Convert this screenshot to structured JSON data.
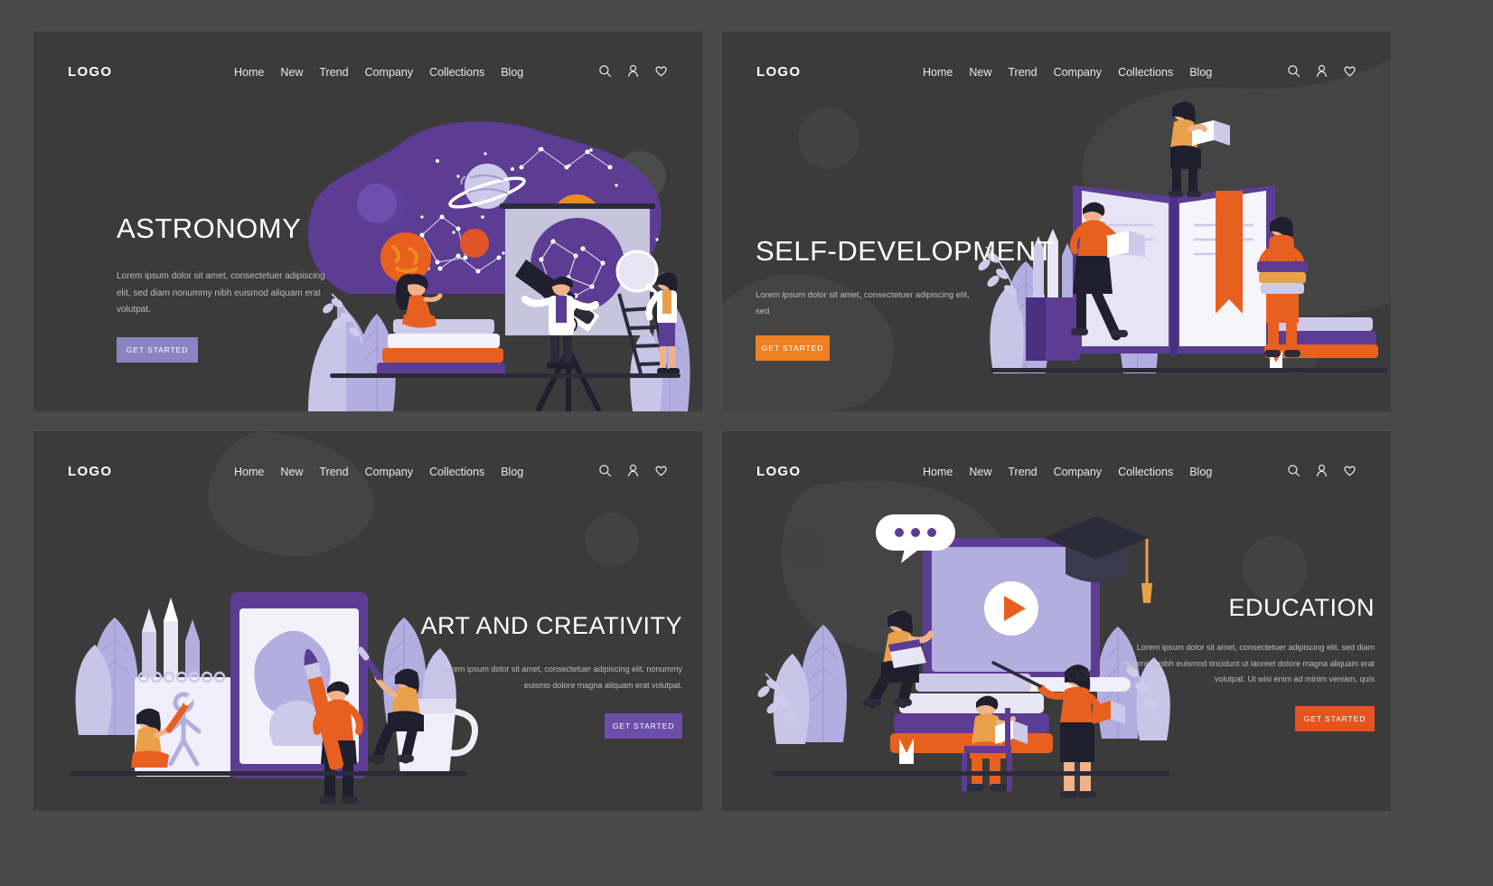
{
  "brand": {
    "logo": "LOGO"
  },
  "nav": {
    "items": [
      "Home",
      "New",
      "Trend",
      "Company",
      "Collections",
      "Blog"
    ],
    "icons": [
      "search-icon",
      "user-icon",
      "heart-icon"
    ]
  },
  "panels": [
    {
      "id": "astronomy",
      "title": "ASTRONOMY",
      "body": "Lorem ipsum dolor sit amet, consectetuer adipiscing elit, sed diam nonummy nibh euismod aliquam erat volutpat.",
      "cta": "GET STARTED",
      "cta_color": "#8b84c2",
      "align": "left",
      "illustration": "astronomy-scene"
    },
    {
      "id": "self-development",
      "title": "SELF-DEVELOPMENT",
      "body": "Lorem ipsum dolor sit amet, consectetuer adipiscing elit, sed",
      "cta": "GET STARTED",
      "cta_color": "#ef8022",
      "align": "left",
      "illustration": "open-book-scene"
    },
    {
      "id": "art-and-creativity",
      "title": "ART AND CREATIVITY",
      "body": "Lorem ipsum dolor sit amet, consectetuer adipiscing elit, nonummy euismo dolore magna aliquam erat volutpat.",
      "cta": "GET STARTED",
      "cta_color": "#6a4ea8",
      "align": "right",
      "illustration": "canvas-paint-scene"
    },
    {
      "id": "education",
      "title": "EDUCATION",
      "body": "Lorem ipsum dolor sit amet, consectetuer adipiscing elit, sed diam nonummy nibh euismod tincidunt ut laoreet dolore magna aliquam erat volutpat. Ut wisi enim ad minim veniam, quis",
      "cta": "GET STARTED",
      "cta_color": "#e8521f",
      "align": "right",
      "illustration": "video-lesson-scene"
    }
  ],
  "theme": {
    "page_bg": "#4a4a4a",
    "panel_bg": "#3b3b3b",
    "purple": "#5c3d93",
    "light_purple": "#b2aee0",
    "orange": "#ef8022",
    "white": "#ffffff"
  }
}
